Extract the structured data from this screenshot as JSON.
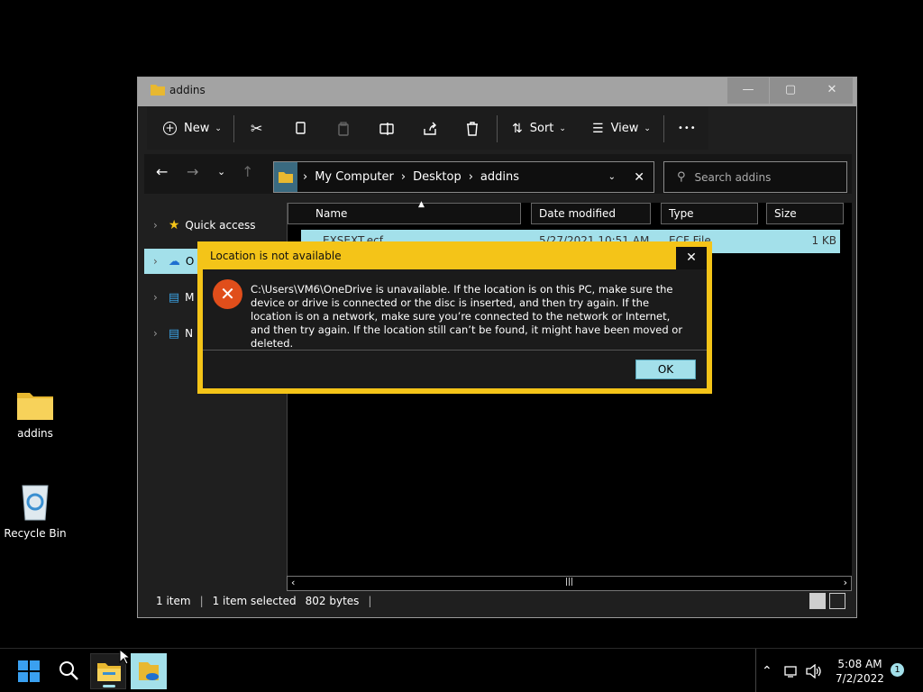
{
  "desktop": {
    "icons": [
      {
        "label": "addins"
      },
      {
        "label": "Recycle Bin"
      }
    ]
  },
  "explorer": {
    "title": "addins",
    "toolbar": {
      "new_label": "New",
      "sort_label": "Sort",
      "view_label": "View",
      "more_label": "•••"
    },
    "address": {
      "segments": [
        "My Computer",
        "Desktop",
        "addins"
      ]
    },
    "search": {
      "placeholder": "Search addins"
    },
    "sidebar": {
      "items": [
        {
          "label": "Quick access"
        },
        {
          "label": "O"
        },
        {
          "label": "M"
        },
        {
          "label": "N"
        }
      ]
    },
    "columns": {
      "name": "Name",
      "date": "Date modified",
      "type": "Type",
      "size": "Size"
    },
    "files": [
      {
        "name": "EXSEXT.ecf",
        "date": "5/27/2021 10:51 AM",
        "type": "ECF File",
        "size": "1 KB"
      }
    ],
    "status": {
      "items": "1 item",
      "selected": "1 item selected",
      "bytes": "802 bytes"
    }
  },
  "dialog": {
    "title": "Location is not available",
    "message": "C:\\Users\\VM6\\OneDrive is unavailable. If the location is on this PC, make sure the device or drive is connected or the disc is inserted, and then try again. If the location is on a network, make sure you’re connected to the network or Internet, and then try again. If the location still can’t be found, it might have been moved or deleted.",
    "ok_label": "OK",
    "close_label": "✕"
  },
  "taskbar": {
    "time": "5:08 AM",
    "date": "7/2/2022",
    "notification_count": "1"
  },
  "colors": {
    "accent": "#a3e0ea",
    "dialog_border": "#f4c418",
    "error": "#e04e1b"
  }
}
